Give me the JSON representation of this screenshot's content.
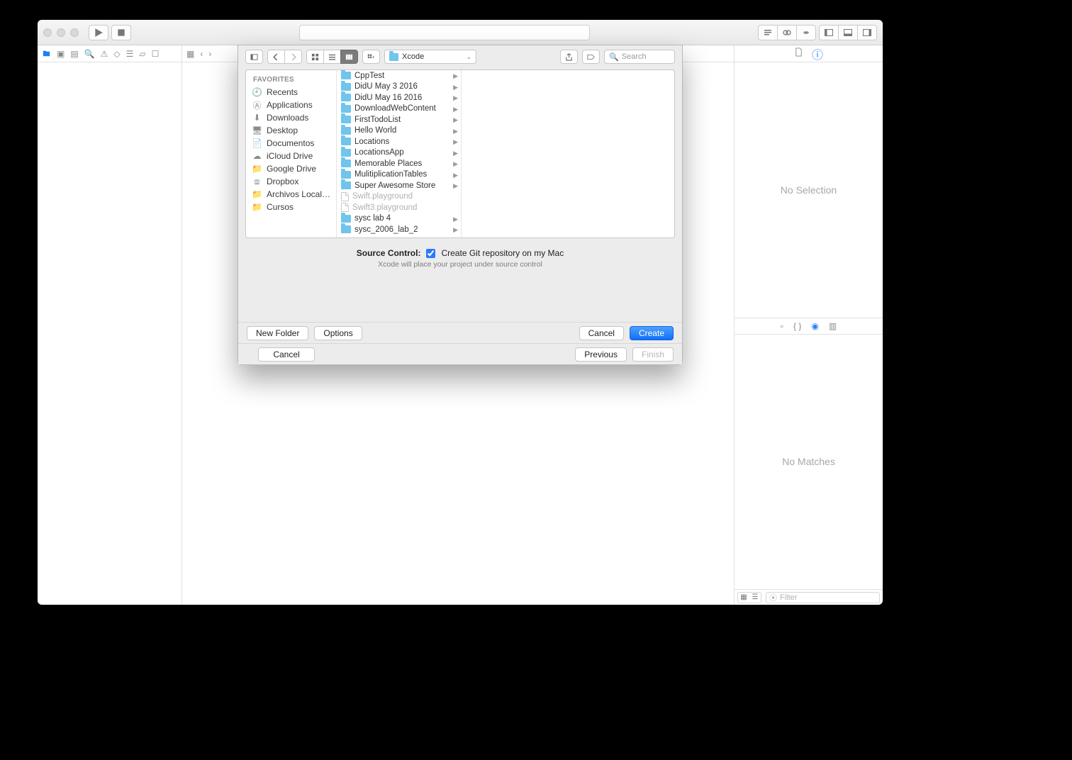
{
  "sheet": {
    "location": "Xcode",
    "search_placeholder": "Search",
    "sidebar_header": "Favorites",
    "sidebar_items": [
      {
        "label": "Recents",
        "icon": "clock"
      },
      {
        "label": "Applications",
        "icon": "apps"
      },
      {
        "label": "Downloads",
        "icon": "download"
      },
      {
        "label": "Desktop",
        "icon": "desktop"
      },
      {
        "label": "Documentos",
        "icon": "doc"
      },
      {
        "label": "iCloud Drive",
        "icon": "cloud"
      },
      {
        "label": "Google Drive",
        "icon": "folder"
      },
      {
        "label": "Dropbox",
        "icon": "dropbox"
      },
      {
        "label": "Archivos Local…",
        "icon": "folder"
      },
      {
        "label": "Cursos",
        "icon": "folder"
      }
    ],
    "column1": [
      {
        "label": "CppTest",
        "type": "folder"
      },
      {
        "label": "DidU May 3 2016",
        "type": "folder"
      },
      {
        "label": "DidU May 16 2016",
        "type": "folder"
      },
      {
        "label": "DownloadWebContent",
        "type": "folder"
      },
      {
        "label": "FirstTodoList",
        "type": "folder"
      },
      {
        "label": "Hello World",
        "type": "folder"
      },
      {
        "label": "Locations",
        "type": "folder"
      },
      {
        "label": "LocationsApp",
        "type": "folder"
      },
      {
        "label": "Memorable Places",
        "type": "folder"
      },
      {
        "label": "MulitiplicationTables",
        "type": "folder"
      },
      {
        "label": "Super Awesome Store",
        "type": "folder"
      },
      {
        "label": "Swift.playground",
        "type": "file",
        "dim": true
      },
      {
        "label": "Swift3.playground",
        "type": "file",
        "dim": true
      },
      {
        "label": "sysc lab 4",
        "type": "folder"
      },
      {
        "label": "sysc_2006_lab_2",
        "type": "folder"
      }
    ],
    "source_control": {
      "label": "Source Control:",
      "checkbox_label": "Create Git repository on my Mac",
      "sub": "Xcode will place your project under source control",
      "checked": true
    },
    "buttons": {
      "new_folder": "New Folder",
      "options": "Options",
      "cancel": "Cancel",
      "create": "Create"
    },
    "wizard": {
      "cancel": "Cancel",
      "previous": "Previous",
      "finish": "Finish"
    }
  },
  "inspector": {
    "no_selection": "No Selection",
    "no_matches": "No Matches",
    "filter_placeholder": "Filter"
  }
}
